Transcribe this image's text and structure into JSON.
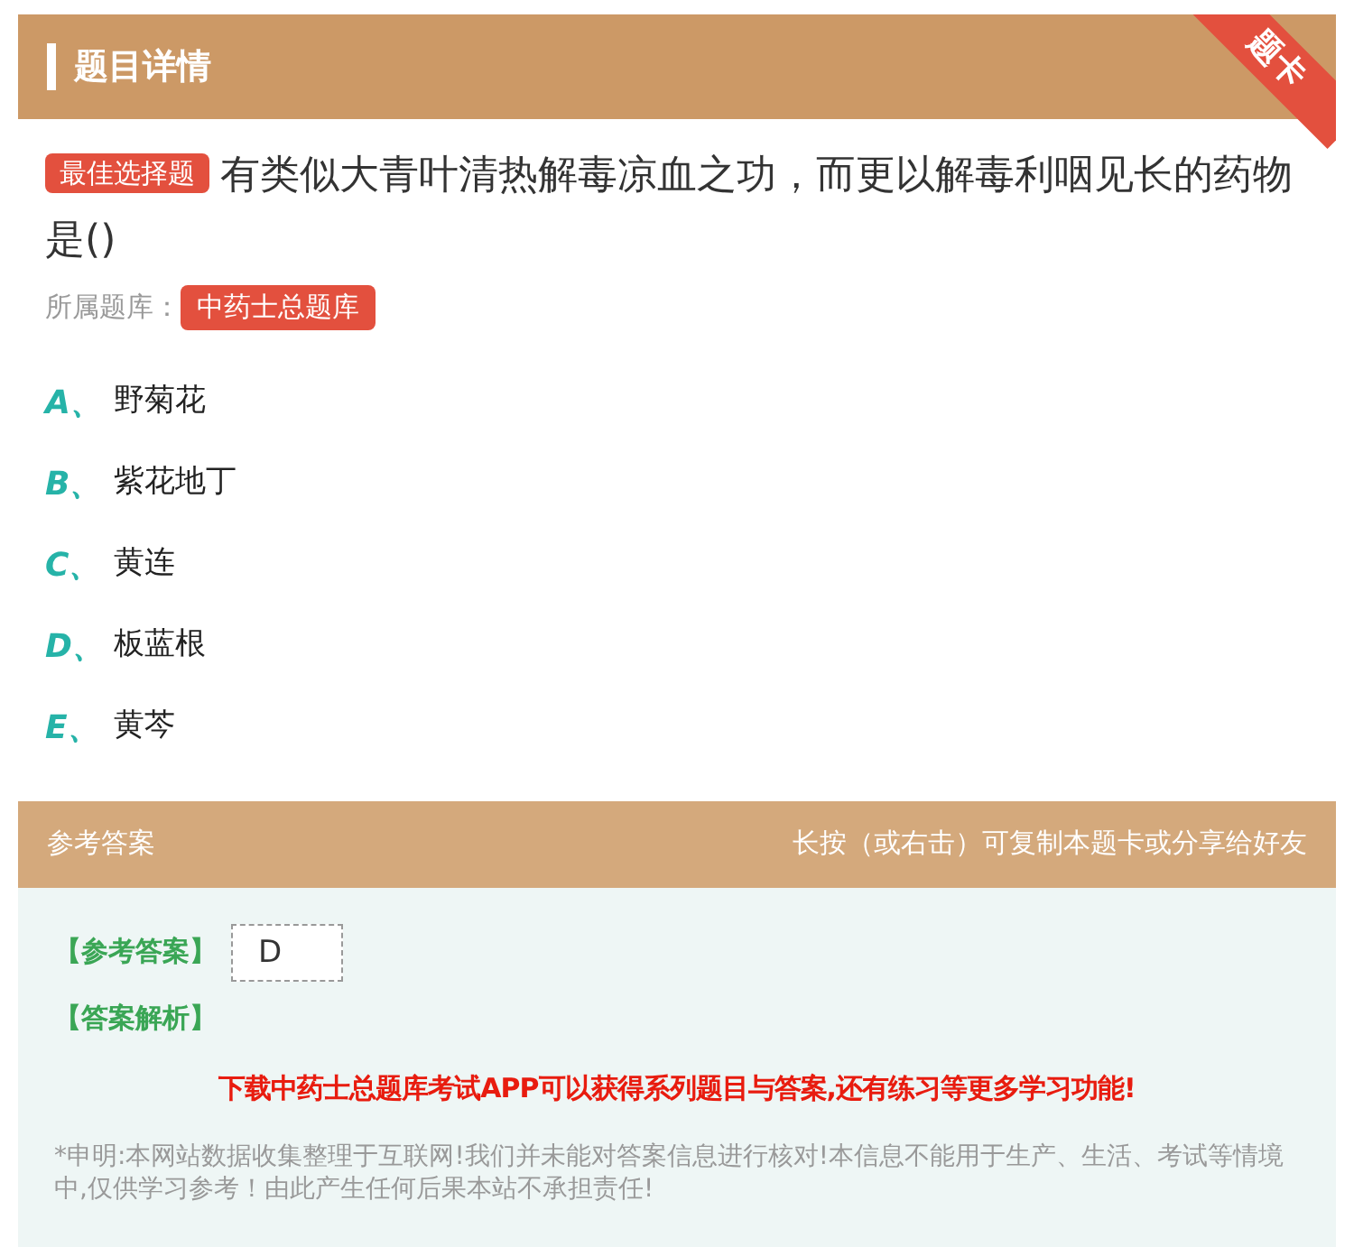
{
  "header": {
    "title": "题目详情",
    "ribbon": "题卡"
  },
  "question": {
    "type_badge": "最佳选择题",
    "text": "有类似大青叶清热解毒凉血之功，而更以解毒利咽见长的药物是()",
    "bank_label": "所属题库：",
    "bank_badge": "中药士总题库"
  },
  "options": [
    {
      "letter": "A、",
      "text": "野菊花"
    },
    {
      "letter": "B、",
      "text": "紫花地丁"
    },
    {
      "letter": "C、",
      "text": "黄连"
    },
    {
      "letter": "D、",
      "text": "板蓝根"
    },
    {
      "letter": "E、",
      "text": "黄芩"
    }
  ],
  "answer_section": {
    "title": "参考答案",
    "hint": "长按（或右击）可复制本题卡或分享给好友",
    "answer_label": "【参考答案】",
    "answer_value": "D",
    "analysis_label": "【答案解析】",
    "promo": "下载中药士总题库考试APP可以获得系列题目与答案,还有练习等更多学习功能!",
    "disclaimer": "*申明:本网站数据收集整理于互联网!我们并未能对答案信息进行核对!本信息不能用于生产、生活、考试等情境中,仅供学习参考！由此产生任何后果本站不承担责任!"
  }
}
